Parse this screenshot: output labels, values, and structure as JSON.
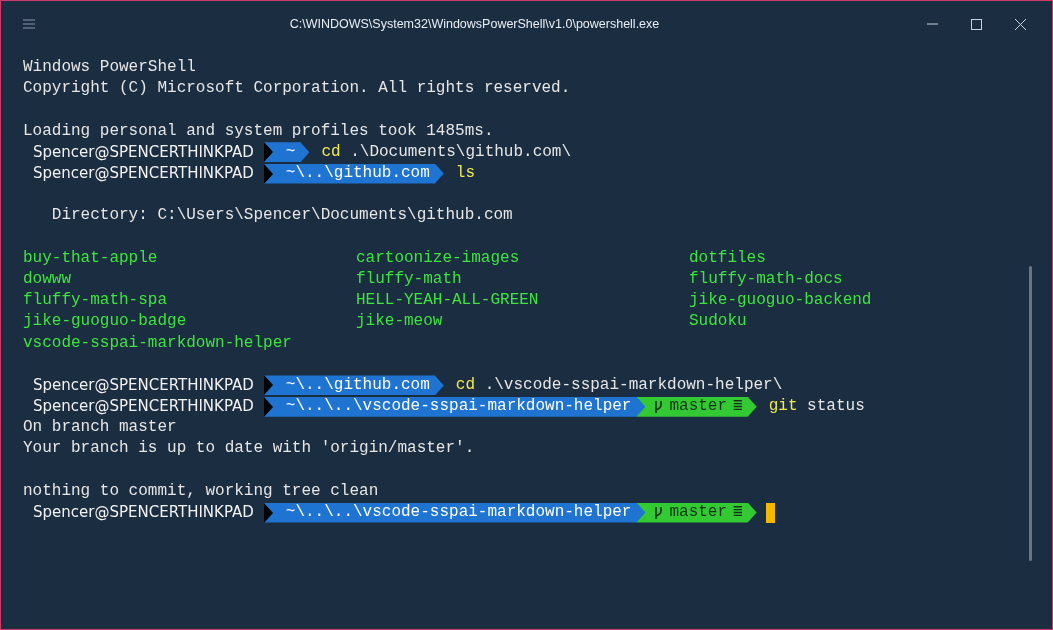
{
  "window": {
    "title": "C:\\WINDOWS\\System32\\WindowsPowerShell\\v1.0\\powershell.exe"
  },
  "lines": [
    {
      "kind": "text",
      "text": "Windows PowerShell"
    },
    {
      "kind": "text",
      "text": "Copyright (C) Microsoft Corporation. All rights reserved."
    },
    {
      "kind": "blank"
    },
    {
      "kind": "text",
      "text": "Loading personal and system profiles took 1485ms."
    },
    {
      "kind": "prompt",
      "user": "Spencer@SPENCERTHINKPAD",
      "path": "~",
      "command": "cd",
      "args": ".\\Documents\\github.com\\"
    },
    {
      "kind": "prompt",
      "user": "Spencer@SPENCERTHINKPAD",
      "path": "~\\..\\github.com",
      "command": "ls"
    },
    {
      "kind": "blank"
    },
    {
      "kind": "text",
      "text": "   Directory: C:\\Users\\Spencer\\Documents\\github.com"
    },
    {
      "kind": "blank"
    },
    {
      "kind": "listing",
      "items": [
        "buy-that-apple",
        "cartoonize-images",
        "dotfiles",
        "dowww",
        "fluffy-math",
        "fluffy-math-docs",
        "fluffy-math-spa",
        "HELL-YEAH-ALL-GREEN",
        "jike-guoguo-backend",
        "jike-guoguo-badge",
        "jike-meow",
        "Sudoku",
        "vscode-sspai-markdown-helper"
      ]
    },
    {
      "kind": "blank"
    },
    {
      "kind": "prompt",
      "user": "Spencer@SPENCERTHINKPAD",
      "path": "~\\..\\github.com",
      "command": "cd",
      "args": ".\\vscode-sspai-markdown-helper\\"
    },
    {
      "kind": "prompt",
      "user": "Spencer@SPENCERTHINKPAD",
      "path": "~\\..\\..\\vscode-sspai-markdown-helper",
      "git": {
        "branch": "master",
        "status": "≣"
      },
      "command": "git",
      "args": "status"
    },
    {
      "kind": "text",
      "text": "On branch master"
    },
    {
      "kind": "text",
      "text": "Your branch is up to date with 'origin/master'."
    },
    {
      "kind": "blank"
    },
    {
      "kind": "text",
      "text": "nothing to commit, working tree clean"
    },
    {
      "kind": "prompt",
      "user": "Spencer@SPENCERTHINKPAD",
      "path": "~\\..\\..\\vscode-sspai-markdown-helper",
      "git": {
        "branch": "master",
        "status": "≣"
      },
      "cursor": true
    }
  ]
}
